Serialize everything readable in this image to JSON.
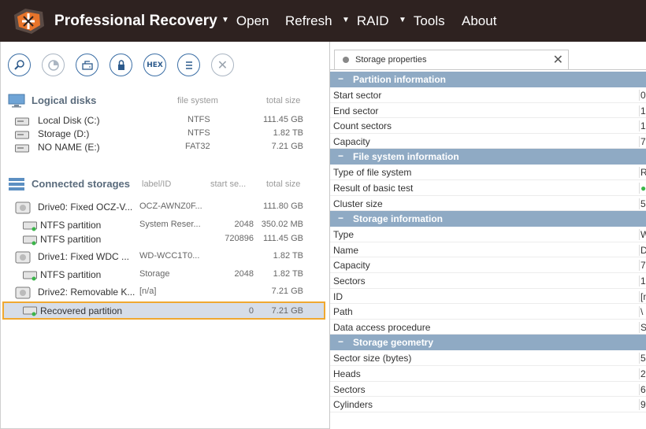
{
  "app": {
    "title": "Professional Recovery"
  },
  "menu": [
    {
      "label": "Open",
      "has_arrow": true
    },
    {
      "label": "Refresh",
      "has_arrow": false
    },
    {
      "label": "RAID",
      "has_arrow": true
    },
    {
      "label": "Tools",
      "has_arrow": true
    },
    {
      "label": "About",
      "has_arrow": false
    }
  ],
  "toolbar": {
    "hex_label": "HEX"
  },
  "logical_disks": {
    "title": "Logical disks",
    "col_fs": "file system",
    "col_size": "total size",
    "items": [
      {
        "name": "Local Disk (C:)",
        "fs": "NTFS",
        "size": "111.45 GB"
      },
      {
        "name": "Storage (D:)",
        "fs": "NTFS",
        "size": "1.82 TB"
      },
      {
        "name": "NO NAME (E:)",
        "fs": "FAT32",
        "size": "7.21 GB"
      }
    ]
  },
  "connected_storages": {
    "title": "Connected storages",
    "col_label": "label/ID",
    "col_start": "start se...",
    "col_size": "total size",
    "items": [
      {
        "name": "Drive0: Fixed OCZ-V...",
        "label": "OCZ-AWNZ0F...",
        "start": "",
        "size": "111.80 GB",
        "kind": "drive"
      },
      {
        "name": "NTFS partition",
        "label": "System Reser...",
        "start": "2048",
        "size": "350.02 MB",
        "kind": "partition"
      },
      {
        "name": "NTFS partition",
        "label": "",
        "start": "720896",
        "size": "111.45 GB",
        "kind": "partition"
      },
      {
        "name": "Drive1: Fixed WDC ...",
        "label": "WD-WCC1T0...",
        "start": "",
        "size": "1.82 TB",
        "kind": "drive"
      },
      {
        "name": "NTFS partition",
        "label": "Storage",
        "start": "2048",
        "size": "1.82 TB",
        "kind": "partition"
      },
      {
        "name": "Drive2: Removable K...",
        "label": "[n/a]",
        "start": "",
        "size": "7.21 GB",
        "kind": "drive"
      },
      {
        "name": "Recovered partition",
        "label": "",
        "start": "0",
        "size": "7.21 GB",
        "kind": "partition",
        "selected": true
      }
    ]
  },
  "properties_tab": {
    "label": "Storage properties"
  },
  "property_groups": [
    {
      "title": "Partition information",
      "rows": [
        {
          "key": "Start sector",
          "value": "0"
        },
        {
          "key": "End sector",
          "value": "1"
        },
        {
          "key": "Count sectors",
          "value": "1"
        },
        {
          "key": "Capacity",
          "value": "7"
        }
      ]
    },
    {
      "title": "File system information",
      "rows": [
        {
          "key": "Type of file system",
          "value": "R"
        },
        {
          "key": "Result of basic test",
          "value": "●",
          "green": true
        },
        {
          "key": "Cluster size",
          "value": "5"
        }
      ]
    },
    {
      "title": "Storage information",
      "rows": [
        {
          "key": "Type",
          "value": "W"
        },
        {
          "key": "Name",
          "value": "D"
        },
        {
          "key": "Capacity",
          "value": "7"
        },
        {
          "key": "Sectors",
          "value": "1"
        },
        {
          "key": "ID",
          "value": "[n"
        },
        {
          "key": "Path",
          "value": "\\"
        },
        {
          "key": "Data access procedure",
          "value": "S"
        }
      ]
    },
    {
      "title": "Storage geometry",
      "rows": [
        {
          "key": "Sector size (bytes)",
          "value": "5"
        },
        {
          "key": "Heads",
          "value": "2"
        },
        {
          "key": "Sectors",
          "value": "6"
        },
        {
          "key": "Cylinders",
          "value": "9"
        }
      ]
    }
  ],
  "colors": {
    "titlebar": "#2e2220",
    "group_header": "#8faac4",
    "selection_border": "#f0a830",
    "accent": "#3c6fa6"
  }
}
